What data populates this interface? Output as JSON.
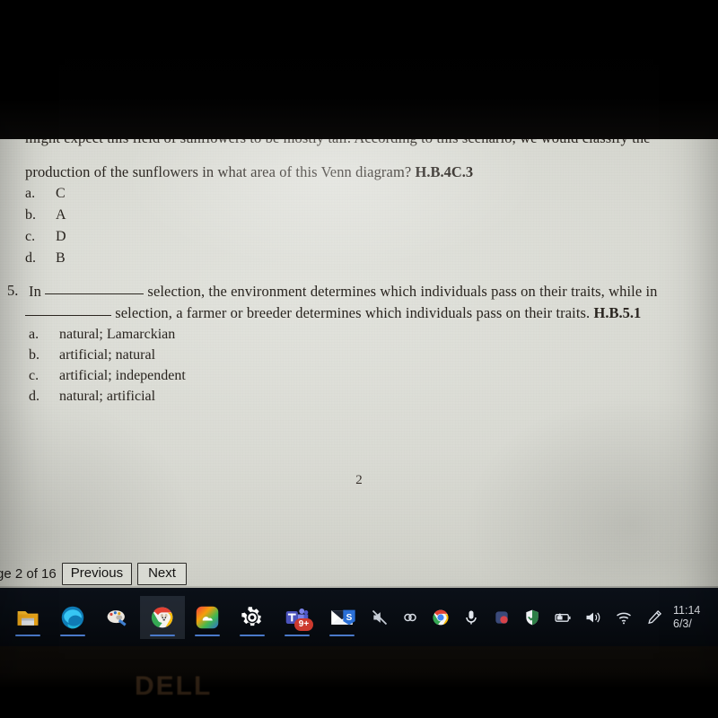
{
  "device": {
    "brand_logo": "DELL"
  },
  "document": {
    "question_4": {
      "clipped_line": "might expect this field of sunflowers to be mostly tall. According to this scenario, we would classify the",
      "line2_text": "production of the sunflowers in what area of this Venn diagram?",
      "standard_code": "H.B.4C.3",
      "options": [
        {
          "letter": "a.",
          "text": "C"
        },
        {
          "letter": "b.",
          "text": "A"
        },
        {
          "letter": "c.",
          "text": "D"
        },
        {
          "letter": "d.",
          "text": "B"
        }
      ]
    },
    "question_5": {
      "number": "5.",
      "stem_part1": "In",
      "stem_part2": "selection, the environment determines which individuals pass on their traits, while in",
      "stem_part3": "selection, a farmer or breeder determines which individuals pass on their traits.",
      "standard_code": "H.B.5.1",
      "options": [
        {
          "letter": "a.",
          "text": "natural; Lamarckian"
        },
        {
          "letter": "b.",
          "text": "artificial; natural"
        },
        {
          "letter": "c.",
          "text": "artificial; independent"
        },
        {
          "letter": "d.",
          "text": "natural; artificial"
        }
      ]
    },
    "page_folio": "2"
  },
  "viewer_nav": {
    "page_indicator": "ge 2 of 16",
    "previous_label": "Previous",
    "next_label": "Next"
  },
  "taskbar": {
    "pinned_apps": [
      {
        "name": "file-explorer-icon",
        "label": "File Explorer",
        "running": true,
        "active": false
      },
      {
        "name": "edge-browser-icon",
        "label": "Microsoft Edge",
        "running": true,
        "active": false
      },
      {
        "name": "paint-icon",
        "label": "Paint",
        "running": false,
        "active": false
      },
      {
        "name": "chrome-dog-icon",
        "label": "Browser Window",
        "running": true,
        "active": true
      },
      {
        "name": "creative-cloud-icon",
        "label": "Adobe Creative Cloud",
        "running": true,
        "active": false
      },
      {
        "name": "settings-gear-icon",
        "label": "Settings",
        "running": true,
        "active": false
      },
      {
        "name": "microsoft-teams-icon",
        "label": "Microsoft Teams",
        "running": true,
        "active": false,
        "badge": "9+"
      },
      {
        "name": "mail-icon",
        "label": "Mail",
        "running": true,
        "active": false
      }
    ],
    "tray_icons": [
      {
        "name": "snipping-tool-icon",
        "label": "S"
      },
      {
        "name": "speaker-muted-icon",
        "label": "Muted"
      },
      {
        "name": "link-icon",
        "label": "Link"
      },
      {
        "name": "chrome-icon",
        "label": "Google Chrome"
      },
      {
        "name": "microphone-icon",
        "label": "Microphone"
      },
      {
        "name": "app-tray-icon",
        "label": "App"
      },
      {
        "name": "windows-defender-shield-icon",
        "label": "Windows Security"
      },
      {
        "name": "battery-icon",
        "label": "Battery"
      },
      {
        "name": "volume-icon",
        "label": "Volume"
      },
      {
        "name": "wifi-icon",
        "label": "Network"
      },
      {
        "name": "pen-icon",
        "label": "Windows Ink"
      }
    ],
    "clock": {
      "time": "11:14",
      "date": "6/3/"
    }
  },
  "colors": {
    "paper": "#d9dad3",
    "ink": "#29241f",
    "taskbar": "#080c12",
    "accent_underline": "#4a79c9",
    "badge_red": "#cc3a2e",
    "dell_logo": "#4a3420"
  }
}
